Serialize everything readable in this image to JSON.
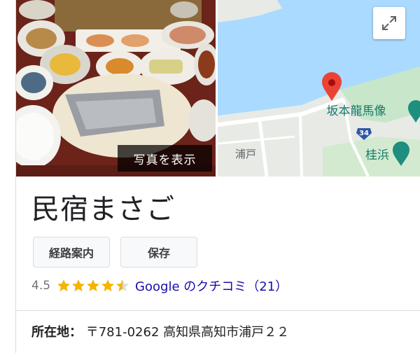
{
  "photo": {
    "button_label": "写真を表示"
  },
  "map": {
    "labels": {
      "landmark": "坂本龍馬像",
      "area": "浦戸",
      "beach": "桂浜",
      "route_number": "34"
    }
  },
  "place": {
    "name": "民宿まさご",
    "actions": {
      "directions_label": "経路案内",
      "save_label": "保存"
    },
    "rating": {
      "score": "4.5",
      "stars": 4.5,
      "reviews_label": "Google のクチコミ（21）"
    },
    "address": {
      "label": "所在地：",
      "value": "〒781-0262 高知県高知市浦戸２２"
    }
  },
  "icons": {
    "expand": "expand-icon",
    "pin": "map-pin-icon",
    "poi": "landmark-poi-icon"
  },
  "colors": {
    "star": "#f4b400",
    "link": "#1a0dab",
    "water": "#aadaff",
    "land": "#e8eae6",
    "pin": "#ea4335",
    "poi": "#1e8e7e"
  }
}
